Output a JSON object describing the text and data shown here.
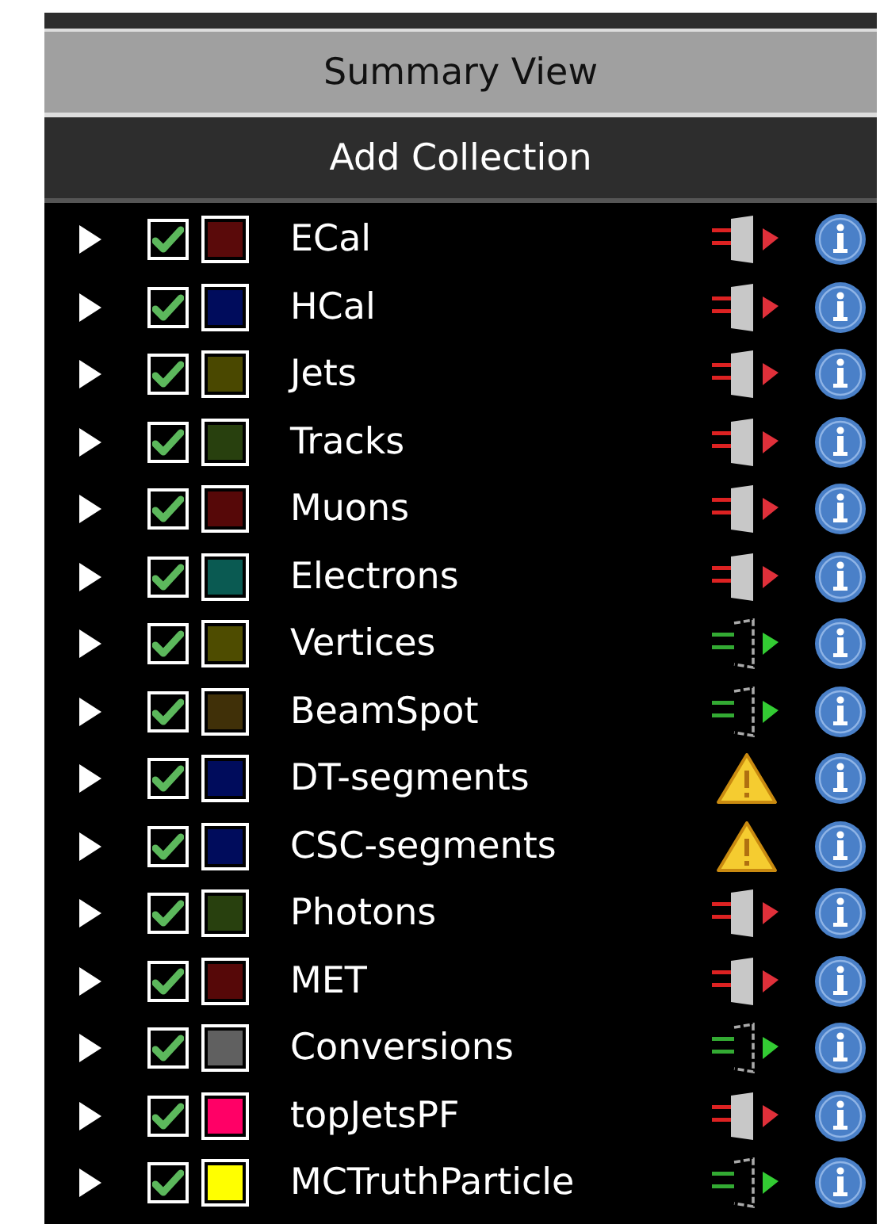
{
  "summary_button": {
    "label": "Summary View"
  },
  "add_button": {
    "label": "Add Collection"
  },
  "collections": [
    {
      "name": "ECal",
      "checked": true,
      "color": "#5a0a0a",
      "kind": "inactive"
    },
    {
      "name": "HCal",
      "checked": true,
      "color": "#000c5c",
      "kind": "inactive"
    },
    {
      "name": "Jets",
      "checked": true,
      "color": "#4a4800",
      "kind": "inactive"
    },
    {
      "name": "Tracks",
      "checked": true,
      "color": "#28400e",
      "kind": "inactive"
    },
    {
      "name": "Muons",
      "checked": true,
      "color": "#560808",
      "kind": "inactive"
    },
    {
      "name": "Electrons",
      "checked": true,
      "color": "#0a5a52",
      "kind": "inactive"
    },
    {
      "name": "Vertices",
      "checked": true,
      "color": "#4e4c00",
      "kind": "active"
    },
    {
      "name": "BeamSpot",
      "checked": true,
      "color": "#403008",
      "kind": "active"
    },
    {
      "name": "DT-segments",
      "checked": true,
      "color": "#000c5c",
      "kind": "warning"
    },
    {
      "name": "CSC-segments",
      "checked": true,
      "color": "#000c5c",
      "kind": "warning"
    },
    {
      "name": "Photons",
      "checked": true,
      "color": "#28400e",
      "kind": "inactive"
    },
    {
      "name": "MET",
      "checked": true,
      "color": "#560808",
      "kind": "inactive"
    },
    {
      "name": "Conversions",
      "checked": true,
      "color": "#606060",
      "kind": "active"
    },
    {
      "name": "topJetsPF",
      "checked": true,
      "color": "#ff0066",
      "kind": "inactive"
    },
    {
      "name": "MCTruthParticle",
      "checked": true,
      "color": "#ffff00",
      "kind": "active"
    }
  ]
}
